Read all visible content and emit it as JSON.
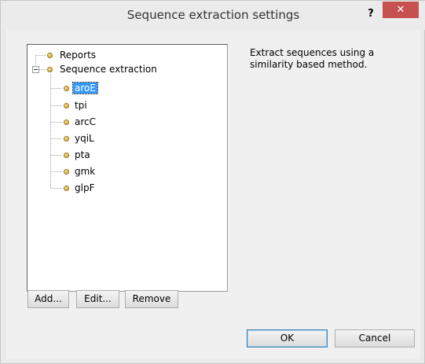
{
  "window": {
    "title": "Sequence extraction settings",
    "help_label": "?",
    "close_label": "✕"
  },
  "tree": {
    "reports_label": "Reports",
    "sequence_extraction_label": "Sequence extraction",
    "children": [
      "aroE",
      "tpi",
      "arcC",
      "yqiL",
      "pta",
      "gmk",
      "glpF"
    ],
    "selected": "aroE"
  },
  "description": "Extract sequences using a similarity based method.",
  "buttons": {
    "add": "Add...",
    "edit": "Edit...",
    "remove": "Remove",
    "ok": "OK",
    "cancel": "Cancel"
  },
  "colors": {
    "selection": "#3399ff",
    "close_button": "#c75050",
    "node_bullet": "#d4a52f"
  }
}
